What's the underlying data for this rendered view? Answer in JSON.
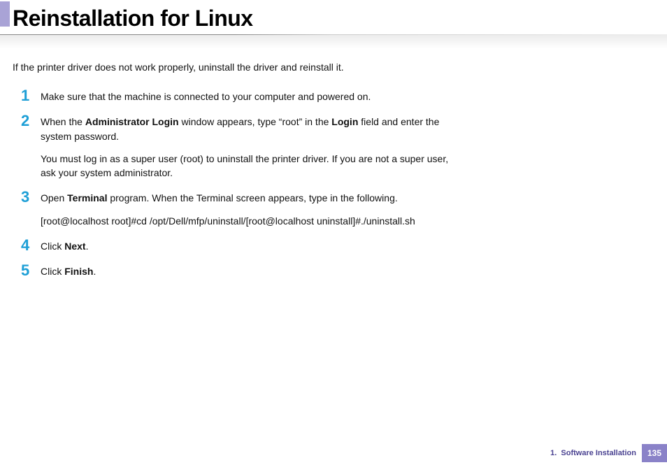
{
  "header": {
    "title": "Reinstallation for Linux"
  },
  "intro": "If the printer driver does not work properly, uninstall the driver and reinstall it.",
  "steps": [
    {
      "num": "1",
      "paragraphs": [
        {
          "runs": [
            {
              "t": "Make sure that the machine is connected to your computer and powered on."
            }
          ]
        }
      ]
    },
    {
      "num": "2",
      "paragraphs": [
        {
          "runs": [
            {
              "t": "When the "
            },
            {
              "t": "Administrator Login",
              "b": true
            },
            {
              "t": " window appears, type “root” in the "
            },
            {
              "t": "Login",
              "b": true
            },
            {
              "t": " field and enter the system password."
            }
          ]
        },
        {
          "runs": [
            {
              "t": "You must log in as a super user (root) to uninstall the printer driver. If you are not a super user, ask your system administrator."
            }
          ]
        }
      ]
    },
    {
      "num": "3",
      "paragraphs": [
        {
          "runs": [
            {
              "t": "Open "
            },
            {
              "t": "Terminal",
              "b": true
            },
            {
              "t": " program. When the Terminal screen appears, type in the following."
            }
          ]
        },
        {
          "runs": [
            {
              "t": "[root@localhost root]#cd /opt/Dell/mfp/uninstall/[root@localhost uninstall]#./uninstall.sh"
            }
          ]
        }
      ]
    },
    {
      "num": "4",
      "paragraphs": [
        {
          "runs": [
            {
              "t": "Click "
            },
            {
              "t": "Next",
              "b": true
            },
            {
              "t": "."
            }
          ]
        }
      ]
    },
    {
      "num": "5",
      "paragraphs": [
        {
          "runs": [
            {
              "t": "Click "
            },
            {
              "t": "Finish",
              "b": true
            },
            {
              "t": "."
            }
          ]
        }
      ]
    }
  ],
  "footer": {
    "section": "1.  Software Installation",
    "page": "135"
  }
}
